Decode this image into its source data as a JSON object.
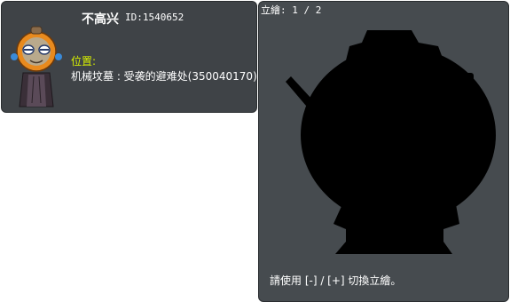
{
  "character": {
    "name": "不高兴",
    "id_text": "ID:1540652",
    "location_label": "位置:",
    "location_value": "机械坟墓 : 受袭的避难处(350040170)"
  },
  "illustration": {
    "counter": "立繪: 1 / 2",
    "hint": "請使用 [-] / [+] 切換立繪。"
  },
  "colors": {
    "panel_bg": "#3f4347",
    "location_label": "#d8f000",
    "silhouette": "#000000"
  },
  "icons": [
    "robot-character-avatar",
    "character-silhouette"
  ]
}
